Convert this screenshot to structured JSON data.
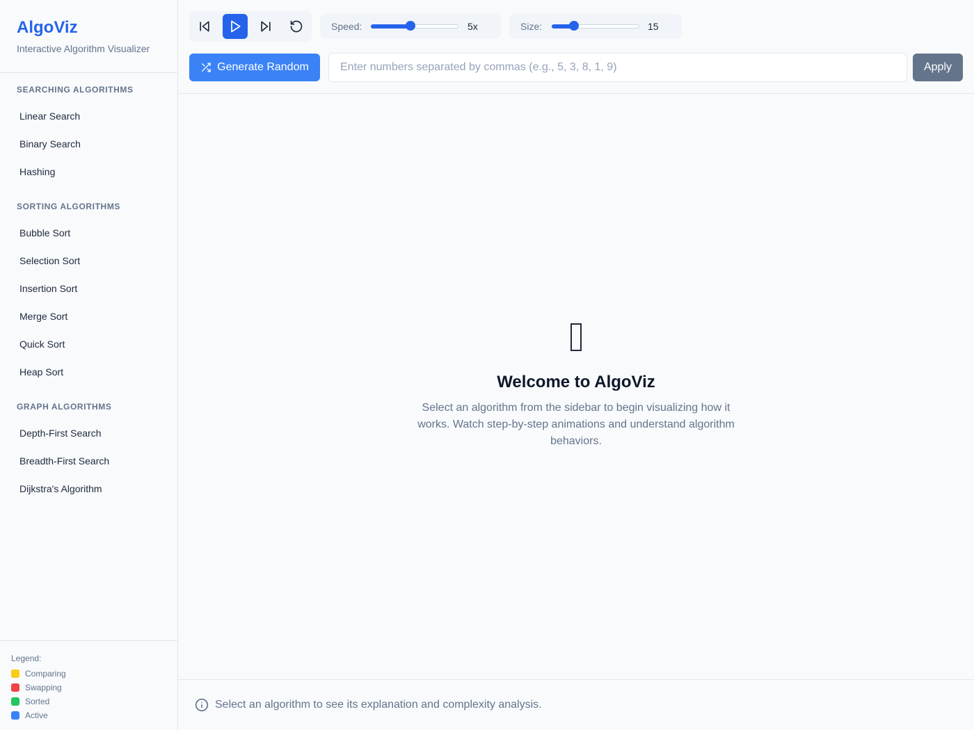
{
  "app": {
    "title": "AlgoViz",
    "subtitle": "Interactive Algorithm Visualizer"
  },
  "sidebar": {
    "sections": [
      {
        "title": "SEARCHING ALGORITHMS",
        "items": [
          "Linear Search",
          "Binary Search",
          "Hashing"
        ]
      },
      {
        "title": "SORTING ALGORITHMS",
        "items": [
          "Bubble Sort",
          "Selection Sort",
          "Insertion Sort",
          "Merge Sort",
          "Quick Sort",
          "Heap Sort"
        ]
      },
      {
        "title": "GRAPH ALGORITHMS",
        "items": [
          "Depth-First Search",
          "Breadth-First Search",
          "Dijkstra's Algorithm"
        ]
      }
    ]
  },
  "legend": {
    "title": "Legend:",
    "items": [
      {
        "label": "Comparing",
        "color": "#facc15"
      },
      {
        "label": "Swapping",
        "color": "#ef4444"
      },
      {
        "label": "Sorted",
        "color": "#22c55e"
      },
      {
        "label": "Active",
        "color": "#3b82f6"
      }
    ]
  },
  "toolbar": {
    "playback_icons": [
      "skip-back-icon",
      "play-icon",
      "skip-forward-icon",
      "reset-icon"
    ],
    "speed": {
      "label": "Speed:",
      "value": "5x",
      "level": 0.45
    },
    "size": {
      "label": "Size:",
      "value": "15",
      "level": 0.25
    },
    "generate_label": "Generate Random",
    "input_placeholder": "Enter numbers separated by commas (e.g., 5, 3, 8, 1, 9)",
    "apply_label": "Apply"
  },
  "main": {
    "welcome_title": "Welcome to AlgoViz",
    "welcome_text": "Select an algorithm from the sidebar to begin visualizing how it works. Watch step-by-step animations and understand algorithm behaviors."
  },
  "info": {
    "text": "Select an algorithm to see its explanation and complexity analysis."
  },
  "colors": {
    "accent": "#2563eb",
    "button_primary": "#3b82f6",
    "button_secondary": "#64748b"
  }
}
